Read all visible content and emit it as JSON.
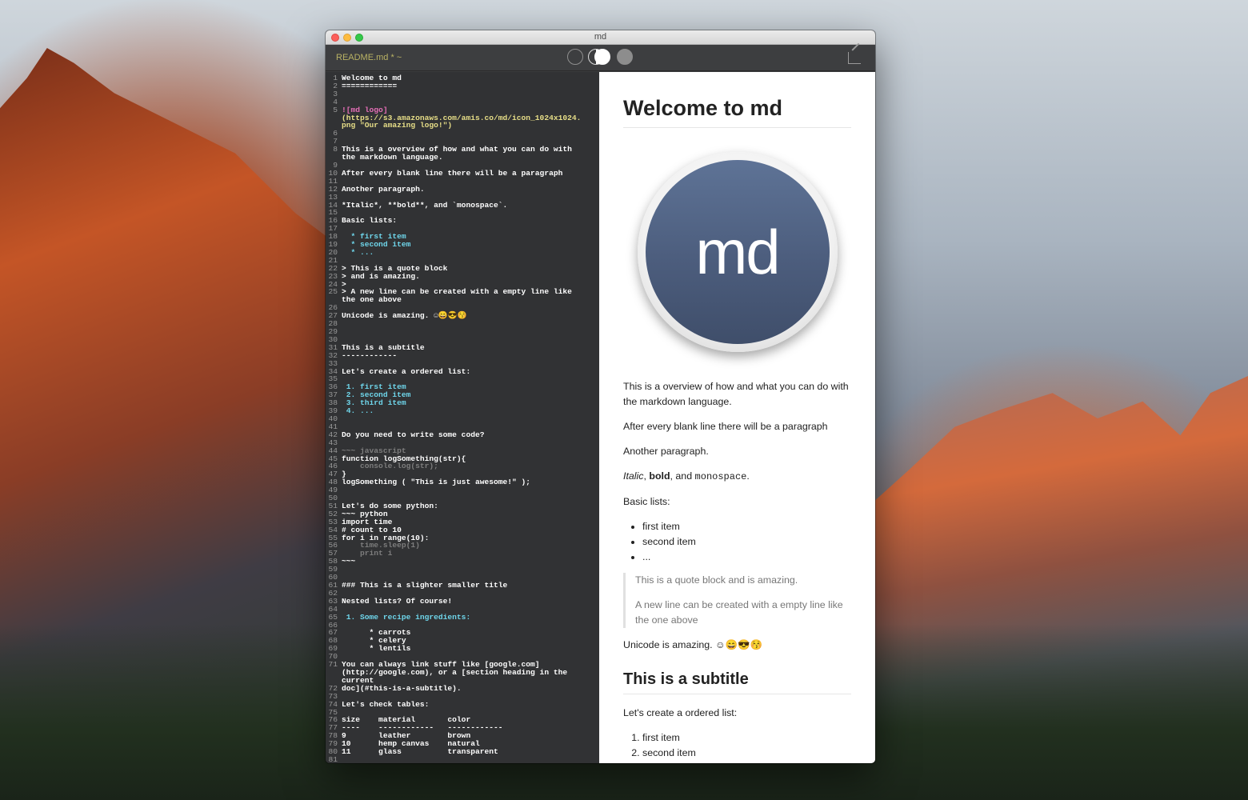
{
  "window": {
    "title": "md"
  },
  "toolbar": {
    "filename": "README.md * ~",
    "modes": [
      "editor-only",
      "split",
      "preview-only"
    ]
  },
  "editor": {
    "lines": [
      {
        "n": "1",
        "t": "Welcome to md",
        "c": "c-heading"
      },
      {
        "n": "2",
        "t": "============",
        "c": "c-heading"
      },
      {
        "n": "3",
        "t": "",
        "c": "c-normal"
      },
      {
        "n": "4",
        "t": "",
        "c": "c-normal"
      },
      {
        "n": "5",
        "t": "![md logo]",
        "c": "c-link"
      },
      {
        "n": "",
        "t": "(https://s3.amazonaws.com/amis.co/md/icon_1024x1024.",
        "c": "c-url"
      },
      {
        "n": "",
        "t": "png \"Our amazing logo!\")",
        "c": "c-url"
      },
      {
        "n": "6",
        "t": "",
        "c": "c-normal"
      },
      {
        "n": "7",
        "t": "",
        "c": "c-normal"
      },
      {
        "n": "8",
        "t": "This is a overview of how and what you can do with",
        "c": "c-normal"
      },
      {
        "n": "",
        "t": "the markdown language.",
        "c": "c-normal"
      },
      {
        "n": "9",
        "t": "",
        "c": "c-normal"
      },
      {
        "n": "10",
        "t": "After every blank line there will be a paragraph",
        "c": "c-normal"
      },
      {
        "n": "11",
        "t": "",
        "c": "c-normal"
      },
      {
        "n": "12",
        "t": "Another paragraph.",
        "c": "c-normal"
      },
      {
        "n": "13",
        "t": "",
        "c": "c-normal"
      },
      {
        "n": "14",
        "t": "*Italic*, **bold**, and `monospace`.",
        "c": "c-normal"
      },
      {
        "n": "15",
        "t": "",
        "c": "c-normal"
      },
      {
        "n": "16",
        "t": "Basic lists:",
        "c": "c-normal"
      },
      {
        "n": "17",
        "t": "",
        "c": "c-normal"
      },
      {
        "n": "18",
        "t": "  * first item",
        "c": "c-list"
      },
      {
        "n": "19",
        "t": "  * second item",
        "c": "c-list"
      },
      {
        "n": "20",
        "t": "  * ...",
        "c": "c-list"
      },
      {
        "n": "21",
        "t": "",
        "c": "c-normal"
      },
      {
        "n": "22",
        "t": "> This is a quote block",
        "c": "c-normal"
      },
      {
        "n": "23",
        "t": "> and is amazing.",
        "c": "c-normal"
      },
      {
        "n": "24",
        "t": ">",
        "c": "c-normal"
      },
      {
        "n": "25",
        "t": "> A new line can be created with a empty line like",
        "c": "c-normal"
      },
      {
        "n": "",
        "t": "the one above",
        "c": "c-normal"
      },
      {
        "n": "26",
        "t": "",
        "c": "c-normal"
      },
      {
        "n": "27",
        "t": "Unicode is amazing. ☺😄😎😚",
        "c": "c-normal"
      },
      {
        "n": "28",
        "t": "",
        "c": "c-normal"
      },
      {
        "n": "29",
        "t": "",
        "c": "c-normal"
      },
      {
        "n": "30",
        "t": "",
        "c": "c-normal"
      },
      {
        "n": "31",
        "t": "This is a subtitle",
        "c": "c-heading"
      },
      {
        "n": "32",
        "t": "------------",
        "c": "c-heading"
      },
      {
        "n": "33",
        "t": "",
        "c": "c-normal"
      },
      {
        "n": "34",
        "t": "Let's create a ordered list:",
        "c": "c-normal"
      },
      {
        "n": "35",
        "t": "",
        "c": "c-normal"
      },
      {
        "n": "36",
        "t": " 1. first item",
        "c": "c-list"
      },
      {
        "n": "37",
        "t": " 2. second item",
        "c": "c-list"
      },
      {
        "n": "38",
        "t": " 3. third item",
        "c": "c-list"
      },
      {
        "n": "39",
        "t": " 4. ...",
        "c": "c-list"
      },
      {
        "n": "40",
        "t": "",
        "c": "c-normal"
      },
      {
        "n": "41",
        "t": "",
        "c": "c-normal"
      },
      {
        "n": "42",
        "t": "Do you need to write some code?",
        "c": "c-normal"
      },
      {
        "n": "43",
        "t": "",
        "c": "c-normal"
      },
      {
        "n": "44",
        "t": "~~~ javascript",
        "c": "c-code"
      },
      {
        "n": "45",
        "t": "function logSomething(str){",
        "c": "c-normal"
      },
      {
        "n": "46",
        "t": "    console.log(str);",
        "c": "c-code"
      },
      {
        "n": "47",
        "t": "}",
        "c": "c-normal"
      },
      {
        "n": "48",
        "t": "logSomething ( \"This is just awesome!\" );",
        "c": "c-normal"
      },
      {
        "n": "49",
        "t": "",
        "c": "c-normal"
      },
      {
        "n": "50",
        "t": "",
        "c": "c-normal"
      },
      {
        "n": "51",
        "t": "Let's do some python:",
        "c": "c-normal"
      },
      {
        "n": "52",
        "t": "~~~ python",
        "c": "c-normal"
      },
      {
        "n": "53",
        "t": "import time",
        "c": "c-normal"
      },
      {
        "n": "54",
        "t": "# count to 10",
        "c": "c-heading"
      },
      {
        "n": "55",
        "t": "for i in range(10):",
        "c": "c-normal"
      },
      {
        "n": "56",
        "t": "    time.sleep(1)",
        "c": "c-code"
      },
      {
        "n": "57",
        "t": "    print i",
        "c": "c-code"
      },
      {
        "n": "58",
        "t": "~~~",
        "c": "c-normal"
      },
      {
        "n": "59",
        "t": "",
        "c": "c-normal"
      },
      {
        "n": "60",
        "t": "",
        "c": "c-normal"
      },
      {
        "n": "61",
        "t": "### This is a slighter smaller title",
        "c": "c-heading"
      },
      {
        "n": "62",
        "t": "",
        "c": "c-normal"
      },
      {
        "n": "63",
        "t": "Nested lists? Of course!",
        "c": "c-normal"
      },
      {
        "n": "64",
        "t": "",
        "c": "c-normal"
      },
      {
        "n": "65",
        "t": " 1. Some recipe ingredients:",
        "c": "c-list"
      },
      {
        "n": "66",
        "t": "",
        "c": "c-normal"
      },
      {
        "n": "67",
        "t": "      * carrots",
        "c": "c-normal"
      },
      {
        "n": "68",
        "t": "      * celery",
        "c": "c-normal"
      },
      {
        "n": "69",
        "t": "      * lentils",
        "c": "c-normal"
      },
      {
        "n": "70",
        "t": "",
        "c": "c-normal"
      },
      {
        "n": "71",
        "t": "You can always link stuff like [google.com]",
        "c": "c-normal"
      },
      {
        "n": "",
        "t": "(http://google.com), or a [section heading in the",
        "c": "c-normal"
      },
      {
        "n": "",
        "t": "current",
        "c": "c-normal"
      },
      {
        "n": "72",
        "t": "doc](#this-is-a-subtitle).",
        "c": "c-normal"
      },
      {
        "n": "73",
        "t": "",
        "c": "c-normal"
      },
      {
        "n": "74",
        "t": "Let's check tables:",
        "c": "c-normal"
      },
      {
        "n": "75",
        "t": "",
        "c": "c-normal"
      },
      {
        "n": "76",
        "t": "size    material       color",
        "c": "c-normal"
      },
      {
        "n": "77",
        "t": "----    ------------   ------------",
        "c": "c-normal"
      },
      {
        "n": "78",
        "t": "9       leather        brown",
        "c": "c-normal"
      },
      {
        "n": "79",
        "t": "10      hemp canvas    natural",
        "c": "c-normal"
      },
      {
        "n": "80",
        "t": "11      glass          transparent",
        "c": "c-normal"
      },
      {
        "n": "81",
        "t": "",
        "c": "c-normal"
      }
    ]
  },
  "preview": {
    "h1": "Welcome to md",
    "logo_text": "md",
    "p1": "This is a overview of how and what you can do with the markdown language.",
    "p2": "After every blank line there will be a paragraph",
    "p3": "Another paragraph.",
    "p4": {
      "italic": "Italic",
      "sep1": ", ",
      "bold": "bold",
      "sep2": ", and ",
      "mono": "monospace",
      "end": "."
    },
    "p5": "Basic lists:",
    "list1": [
      "first item",
      "second item",
      "..."
    ],
    "quote": [
      "This is a quote block and is amazing.",
      "A new line can be created with a empty line like the one above"
    ],
    "p6": "Unicode is amazing. ☺😄😎😚",
    "h2": "This is a subtitle",
    "p7": "Let's create a ordered list:",
    "list2": [
      "first item",
      "second item"
    ]
  }
}
